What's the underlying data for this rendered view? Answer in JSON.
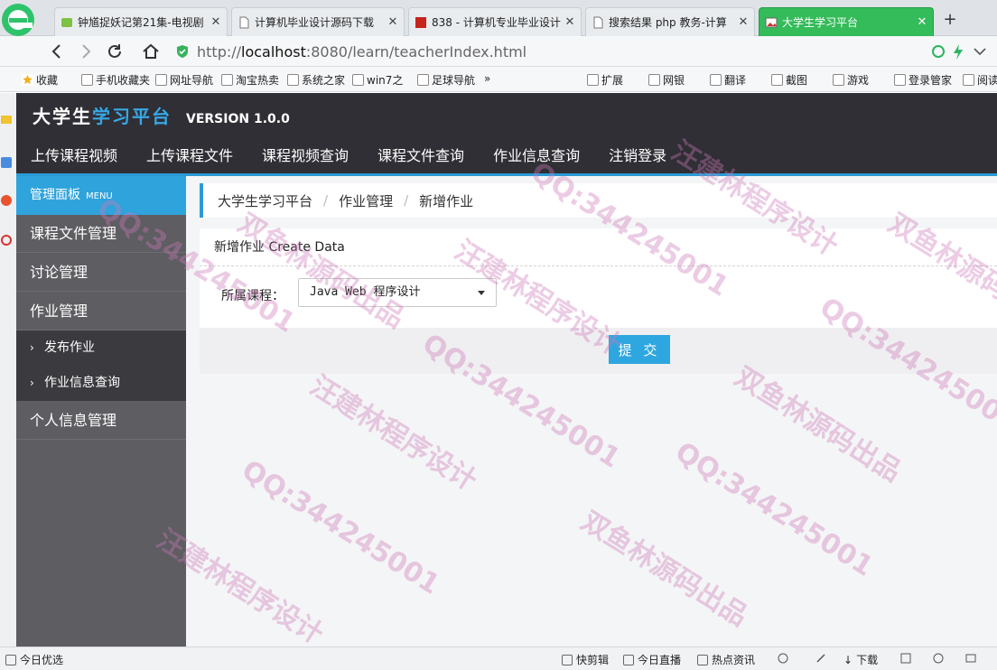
{
  "browser": {
    "tabs": [
      {
        "title": "钟馗捉妖记第21集-电视剧",
        "active": false
      },
      {
        "title": "计算机毕业设计源码下载",
        "active": false
      },
      {
        "title": "838 - 计算机专业毕业设计",
        "active": false
      },
      {
        "title": "搜索结果 php 教务-计算",
        "active": false
      },
      {
        "title": "大学生学习平台",
        "active": true
      }
    ],
    "url_prefix": "http://",
    "url_host": "localhost",
    "url_rest": ":8080/learn/teacherIndex.html",
    "bookmarks": [
      "收藏",
      "手机收藏夹",
      "网址导航",
      "淘宝热卖",
      "系统之家",
      "win7之",
      "足球导航"
    ],
    "bookmarks_more": "»",
    "tools": [
      "扩展",
      "网银",
      "翻译",
      "截图",
      "游戏",
      "登录管家",
      "阅读"
    ]
  },
  "header": {
    "brand_part1": "大学生",
    "brand_part2": "学习平台",
    "version": "VERSION 1.0.0",
    "nav": [
      "上传课程视频",
      "上传课程文件",
      "课程视频查询",
      "课程文件查询",
      "作业信息查询",
      "注销登录"
    ]
  },
  "sidebar": {
    "header": "管理面板",
    "header_sub": "MENU",
    "items": [
      "课程文件管理",
      "讨论管理",
      "作业管理",
      "个人信息管理"
    ],
    "subitems": [
      "发布作业",
      "作业信息查询"
    ],
    "chevron": "›"
  },
  "breadcrumb": {
    "items": [
      "大学生学习平台",
      "作业管理",
      "新增作业"
    ],
    "separator": "/"
  },
  "form": {
    "title": "新增作业 Create Data",
    "course_label": "所属课程：",
    "course_value": "Java Web 程序设计",
    "submit_label": "提 交"
  },
  "watermarks": [
    "QQ:344245001",
    "汪建林程序设计",
    "双鱼林源码出品"
  ],
  "statusbar": {
    "left": "今日优选",
    "items": [
      "快剪辑",
      "今日直播",
      "热点资讯",
      "下载"
    ]
  },
  "colors": {
    "header_bg": "#2f2f35",
    "accent_blue": "#2b9bd8",
    "sidebar_bg": "#5d5d62",
    "submenu_bg": "#3a3a3f",
    "active_tab": "#34bb5a"
  }
}
